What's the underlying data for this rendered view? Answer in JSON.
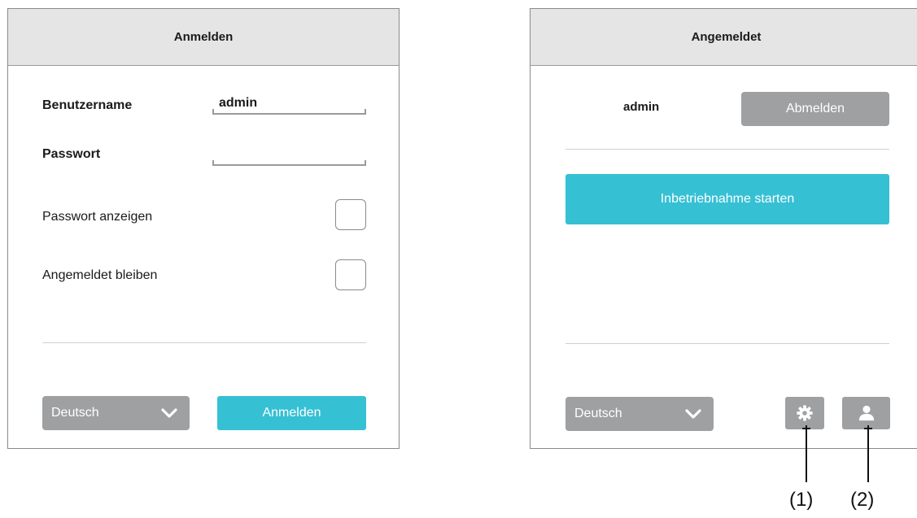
{
  "login_panel": {
    "title": "Anmelden",
    "username_label": "Benutzername",
    "username_value": "admin",
    "password_label": "Passwort",
    "password_value": "",
    "show_password_label": "Passwort anzeigen",
    "stay_logged_in_label": "Angemeldet bleiben",
    "language_value": "Deutsch",
    "login_button_label": "Anmelden"
  },
  "logged_in_panel": {
    "title": "Angemeldet",
    "username": "admin",
    "logout_button_label": "Abmelden",
    "start_commissioning_label": "Inbetriebnahme starten",
    "language_value": "Deutsch",
    "settings_icon": "gear-icon",
    "user_icon": "user-icon"
  },
  "callouts": {
    "settings": "(1)",
    "user": "(2)"
  },
  "colors": {
    "accent": "#36c0d4",
    "button_gray": "#9ea0a2",
    "header_bg": "#e5e5e5"
  }
}
